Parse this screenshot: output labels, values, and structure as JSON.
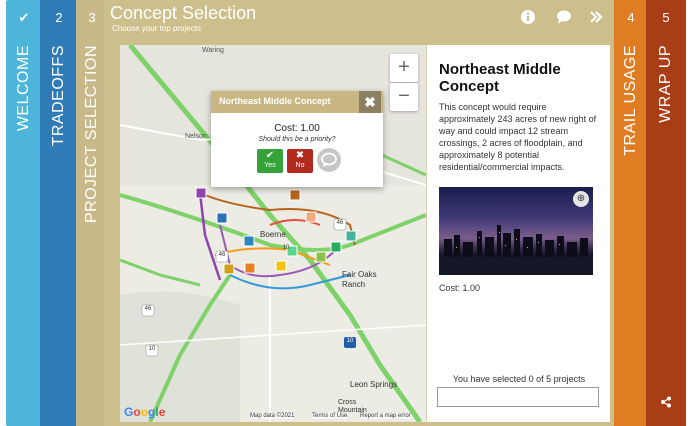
{
  "tabs": [
    {
      "num": "✔",
      "label": "WELCOME",
      "color": "#4db5d9"
    },
    {
      "num": "2",
      "label": "TRADEOFFS",
      "color": "#2f7bb5"
    },
    {
      "num": "3",
      "label": "PROJECT SELECTION",
      "color": "#c9b98a"
    },
    {
      "num": "4",
      "label": "TRAIL USAGE",
      "color": "#e07d22"
    },
    {
      "num": "5",
      "label": "WRAP UP",
      "color": "#a83d16"
    }
  ],
  "header": {
    "title": "Concept Selection",
    "subtitle": "Choose your top projects"
  },
  "map": {
    "zoom_in": "+",
    "zoom_out": "−",
    "places": [
      "Waring",
      "Nelson",
      "Boerne",
      "Fair Oaks Ranch",
      "Leon Springs",
      "Cross Mountain"
    ],
    "route_labels": [
      "46",
      "46",
      "46",
      "10",
      "10",
      "10"
    ],
    "google": "Google",
    "attribution": [
      "Map data ©2021",
      "Terms of Use",
      "Report a map error"
    ]
  },
  "popup": {
    "title": "Northeast Middle Concept",
    "close": "✖",
    "cost": "Cost: 1.00",
    "question": "Should this be a priority?",
    "yes": "Yes",
    "no": "No"
  },
  "panel": {
    "heading": "Northeast Middle Concept",
    "description": "This concept would require approximately 243 acres of new right of way and could impact 12 stream crossings, 2 acres of floodplain, and approximately 8 potential residential/commercial impacts.",
    "cost": "Cost: 1.00",
    "selected": "You have selected 0 of 5 projects"
  },
  "colors": {
    "brand_tan": "#cdbf8c",
    "yes_green": "#36a33a",
    "no_red": "#b32a1e"
  }
}
